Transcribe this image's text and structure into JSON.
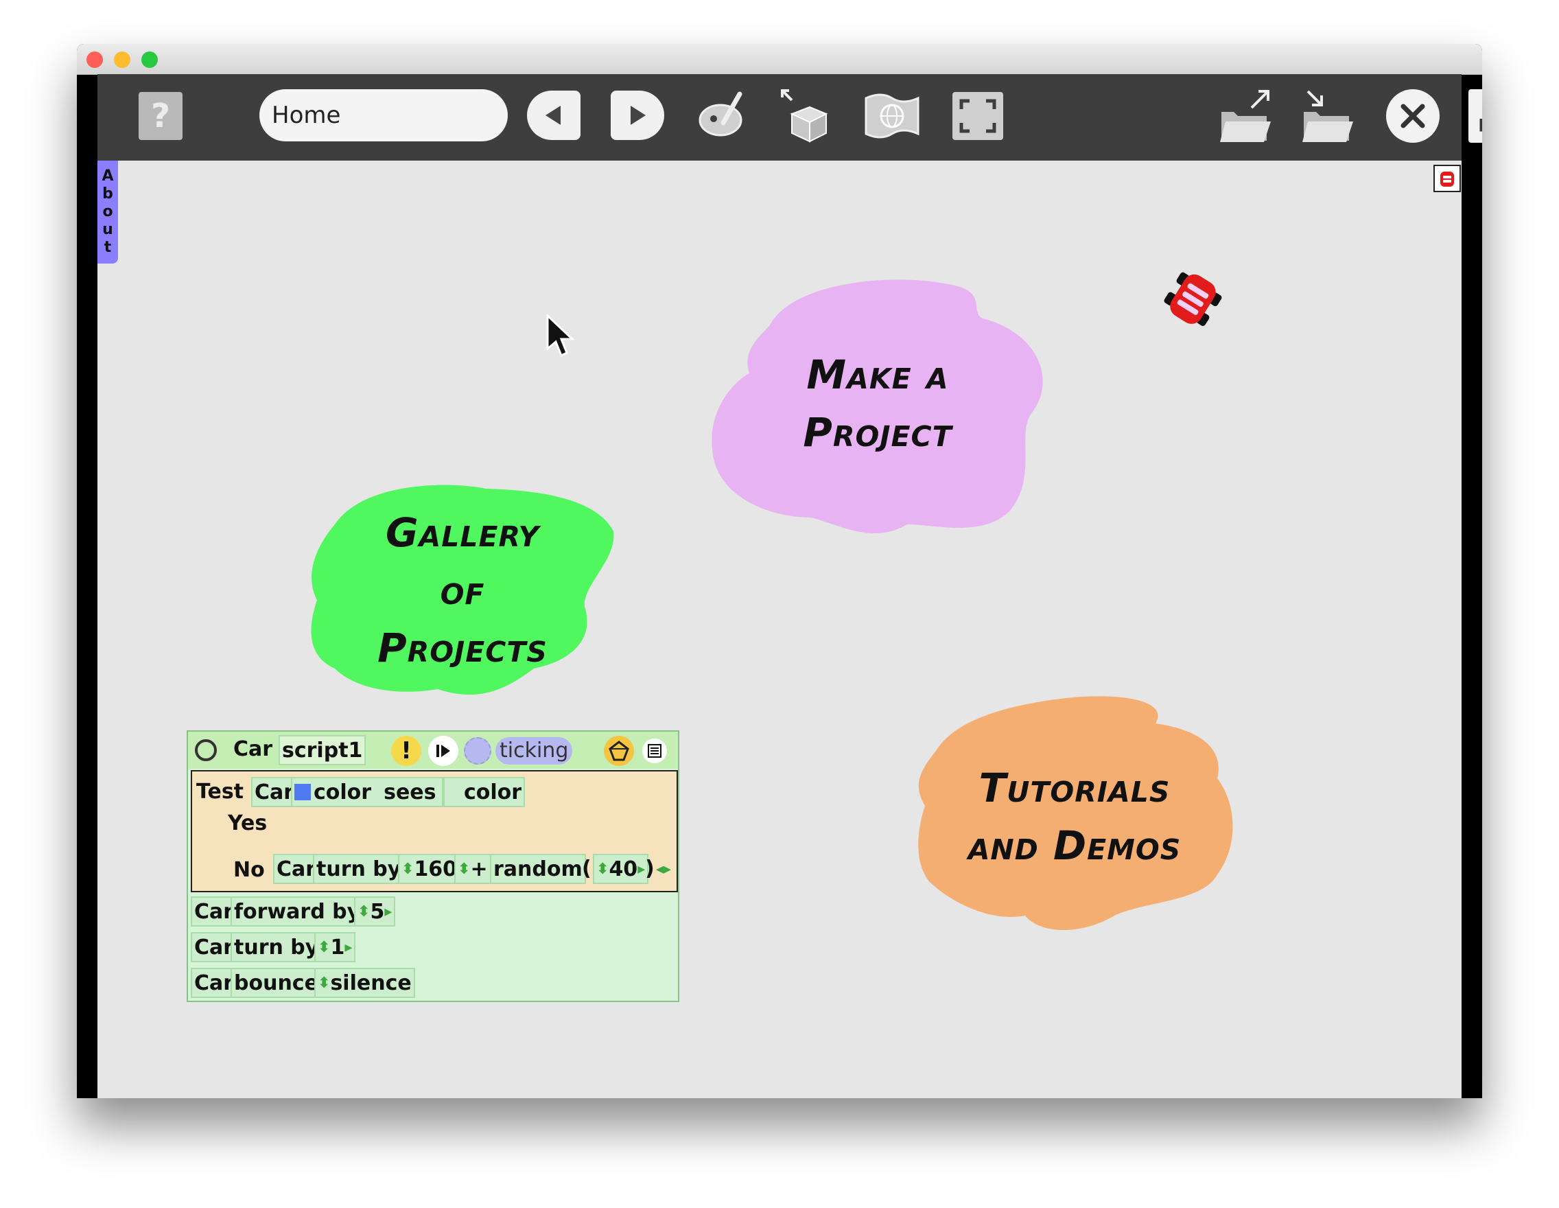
{
  "window": {
    "traffic_lights": {
      "close": "#fe5f57",
      "minimize": "#febc2e",
      "zoom": "#28c840"
    }
  },
  "toolbar": {
    "help_icon": "question-mark-icon",
    "project_name": "Home",
    "prev_icon": "triangle-left-icon",
    "next_icon": "triangle-right-icon",
    "paint_icon": "paint-palette-icon",
    "supplies_icon": "supplies-box-icon",
    "language_icon": "globe-flag-icon",
    "fullscreen_icon": "frame-corners-icon",
    "publish_icon": "folder-export-icon",
    "open_icon": "folder-import-icon",
    "quit_icon": "close-circle-icon",
    "expand_icon": "expand-arrows-icon"
  },
  "stage": {
    "about_tab": [
      "A",
      "b",
      "o",
      "u",
      "t"
    ],
    "blobs": [
      {
        "lines": [
          "Make a",
          "Project"
        ],
        "color": "#e7b3f3"
      },
      {
        "lines": [
          "Gallery",
          "of",
          "Projects"
        ],
        "color": "#50f75e"
      },
      {
        "lines": [
          "Tutorials",
          "and Demos"
        ],
        "color": "#f5ae72"
      }
    ],
    "sprite": "red-car-sprite"
  },
  "script": {
    "player": "Car",
    "name": "script1",
    "status": "ticking",
    "test": {
      "label": "Test",
      "object": "Car",
      "color_swatch": "#4f7af2",
      "predicate_1": "color",
      "sees": "sees",
      "predicate_2": "color",
      "yes": "Yes",
      "no": "No",
      "no_object": "Car",
      "no_cmd": "turn by",
      "no_value": "160",
      "plus": "+",
      "random": "random",
      "open_paren": "(",
      "random_value": "40",
      "close_paren": ")"
    },
    "lines": [
      {
        "object": "Car",
        "command": "forward by",
        "value": "5"
      },
      {
        "object": "Car",
        "command": "turn by",
        "value": "1"
      },
      {
        "object": "Car",
        "command": "bounce",
        "value": "silence"
      }
    ]
  }
}
